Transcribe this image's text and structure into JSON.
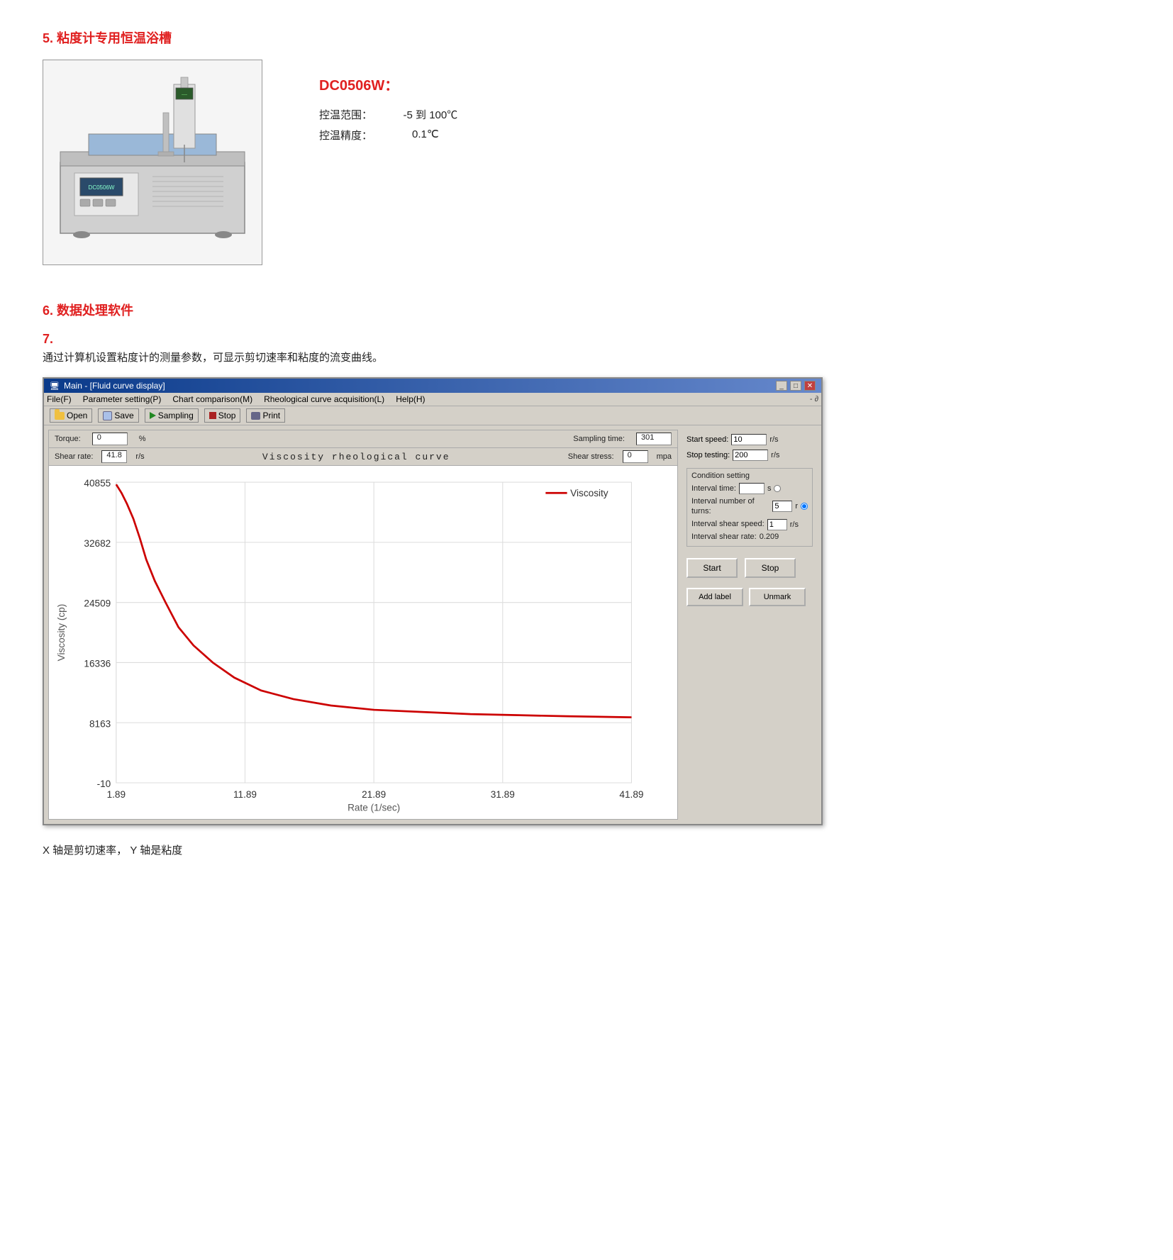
{
  "section5": {
    "title": "5.  粘度计专用恒温浴槽",
    "device_model": "DC0506W：",
    "specs": [
      {
        "label": "控温范围：",
        "sep": "",
        "value": "-5 到 100℃"
      },
      {
        "label": "控温精度：",
        "sep": "",
        "value": "0.1℃"
      }
    ]
  },
  "section6": {
    "title": "6.   数据处理软件"
  },
  "section7": {
    "title": "7.",
    "desc": "通过计算机设置粘度计的测量参数，可显示剪切速率和粘度的流变曲线。"
  },
  "software": {
    "titlebar": "Main - [Fluid curve display]",
    "menus": [
      "File(F)",
      "Parameter setting(P)",
      "Chart comparison(M)",
      "Rheological curve acquisition(L)",
      "Help(H)"
    ],
    "toolbar_btns": [
      "Open",
      "Save",
      "Sampling",
      "Stop",
      "Print"
    ],
    "status": {
      "torque_label": "Torque:",
      "torque_value": "0",
      "torque_unit": "%",
      "sampling_time_label": "Sampling time:",
      "sampling_time_value": "301",
      "shear_rate_label": "Shear rate:",
      "shear_rate_value": "41.8",
      "shear_rate_unit": "r/s",
      "chart_title": "Viscosity rheological curve",
      "shear_stress_label": "Shear stress:",
      "shear_stress_value": "0",
      "shear_stress_unit": "mpa"
    },
    "right_panel": {
      "start_speed_label": "Start speed:",
      "start_speed_value": "10",
      "start_speed_unit": "r/s",
      "stop_testing_label": "Stop testing:",
      "stop_testing_value": "200",
      "stop_testing_unit": "r/s",
      "condition_setting_label": "Condition setting",
      "interval_time_label": "Interval time:",
      "interval_time_value": "",
      "interval_time_unit": "s",
      "interval_turns_label": "Interval number of turns:",
      "interval_turns_value": "5",
      "interval_turns_unit": "r",
      "interval_shear_speed_label": "Interval shear speed:",
      "interval_shear_speed_value": "1",
      "interval_shear_speed_unit": "r/s",
      "interval_shear_rate_label": "Interval shear rate:",
      "interval_shear_rate_value": "0.209",
      "start_btn": "Start",
      "stop_btn": "Stop",
      "add_label_btn": "Add label",
      "unmark_btn": "Unmark"
    },
    "chart": {
      "y_axis_label": "Viscosity (cp)",
      "x_axis_label": "Rate (1/sec)",
      "y_ticks": [
        "40855",
        "32682",
        "24509",
        "16336",
        "8163",
        "-10"
      ],
      "x_ticks": [
        "1.89",
        "11.89",
        "21.89",
        "31.89",
        "41.89"
      ],
      "legend": "Viscosity"
    }
  },
  "footer": {
    "note": "X 轴是剪切速率，   Y 轴是粘度"
  }
}
